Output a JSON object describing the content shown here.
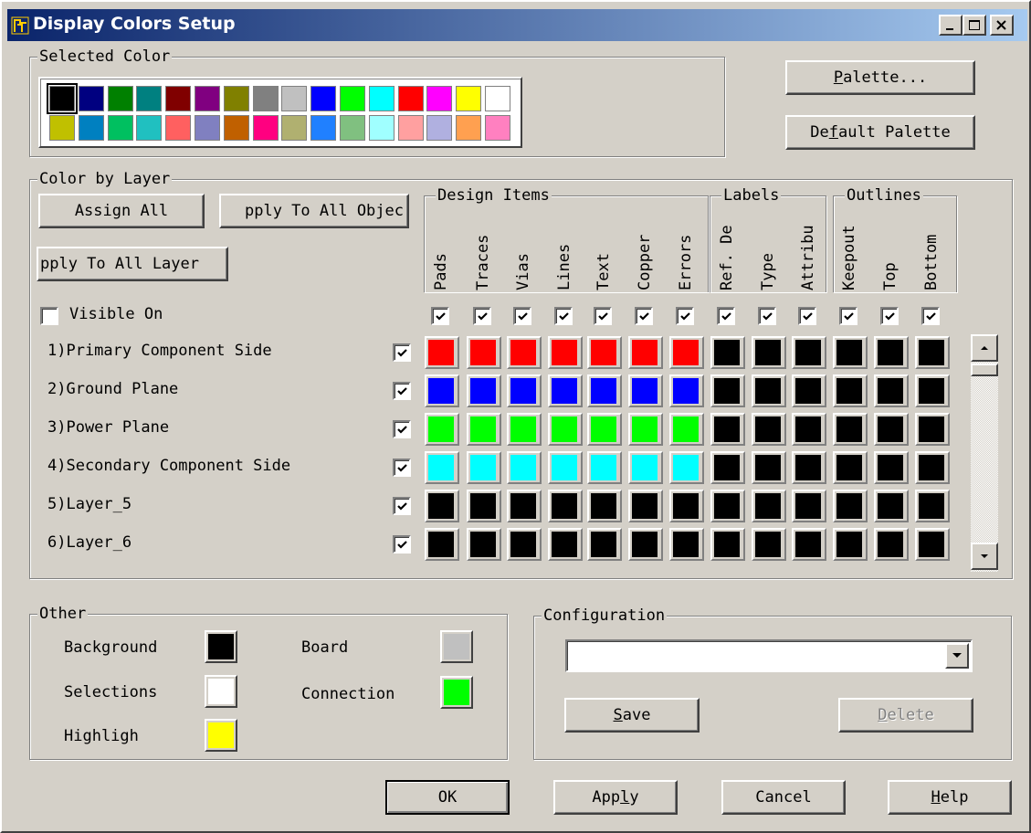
{
  "window": {
    "title": "Display Colors Setup",
    "icon": "app-icon",
    "controls": [
      "minimize-icon",
      "maximize-icon",
      "close-icon"
    ]
  },
  "selected_color": {
    "label": "Selected Color",
    "selected_index": 0,
    "palette": [
      "#000000",
      "#000080",
      "#008000",
      "#008080",
      "#800000",
      "#800080",
      "#808000",
      "#808080",
      "#c0c0c0",
      "#0000ff",
      "#00ff00",
      "#00ffff",
      "#ff0000",
      "#ff00ff",
      "#ffff00",
      "#ffffff",
      "#c0c000",
      "#0080c0",
      "#00c060",
      "#20c0c0",
      "#ff6060",
      "#8080c0",
      "#c06000",
      "#ff0080",
      "#b0b070",
      "#2080ff",
      "#80c080",
      "#a0ffff",
      "#ffa0a0",
      "#b0b0e0",
      "#ffa050",
      "#ff80c0"
    ]
  },
  "palette_buttons": {
    "palette": "Palette...",
    "palette_key": "P",
    "palette_rest": "alette...",
    "default_palette_pre": "De",
    "default_palette_key": "f",
    "default_palette_rest": "ault Palette"
  },
  "color_by_layer": {
    "label": "Color by Layer",
    "assign_all": "Assign All",
    "apply_to_all_objects": "pply To All Objec",
    "apply_to_all_layers": "pply To All Layer",
    "visible_on": "Visible On",
    "visible_on_checked": false,
    "groups": {
      "design_items": "Design Items",
      "labels": "Labels",
      "outlines": "Outlines"
    },
    "columns": [
      "Pads",
      "Traces",
      "Vias",
      "Lines",
      "Text",
      "Copper",
      "Errors",
      "Ref. De",
      "Type",
      "Attribu",
      "Keepout",
      "Top",
      "Bottom"
    ],
    "column_visible": [
      true,
      true,
      true,
      true,
      true,
      true,
      true,
      true,
      true,
      true,
      true,
      true,
      true
    ],
    "layers": [
      {
        "name": "1)Primary Component Side",
        "checked": true,
        "colors": [
          "#ff0000",
          "#ff0000",
          "#ff0000",
          "#ff0000",
          "#ff0000",
          "#ff0000",
          "#ff0000",
          "#000000",
          "#000000",
          "#000000",
          "#000000",
          "#000000",
          "#000000"
        ]
      },
      {
        "name": "2)Ground Plane",
        "checked": true,
        "colors": [
          "#0000ff",
          "#0000ff",
          "#0000ff",
          "#0000ff",
          "#0000ff",
          "#0000ff",
          "#0000ff",
          "#000000",
          "#000000",
          "#000000",
          "#000000",
          "#000000",
          "#000000"
        ]
      },
      {
        "name": "3)Power Plane",
        "checked": true,
        "colors": [
          "#00ff00",
          "#00ff00",
          "#00ff00",
          "#00ff00",
          "#00ff00",
          "#00ff00",
          "#00ff00",
          "#000000",
          "#000000",
          "#000000",
          "#000000",
          "#000000",
          "#000000"
        ]
      },
      {
        "name": "4)Secondary Component Side",
        "checked": true,
        "colors": [
          "#00ffff",
          "#00ffff",
          "#00ffff",
          "#00ffff",
          "#00ffff",
          "#00ffff",
          "#00ffff",
          "#000000",
          "#000000",
          "#000000",
          "#000000",
          "#000000",
          "#000000"
        ]
      },
      {
        "name": "5)Layer_5",
        "checked": true,
        "colors": [
          "#000000",
          "#000000",
          "#000000",
          "#000000",
          "#000000",
          "#000000",
          "#000000",
          "#000000",
          "#000000",
          "#000000",
          "#000000",
          "#000000",
          "#000000"
        ]
      },
      {
        "name": "6)Layer_6",
        "checked": true,
        "colors": [
          "#000000",
          "#000000",
          "#000000",
          "#000000",
          "#000000",
          "#000000",
          "#000000",
          "#000000",
          "#000000",
          "#000000",
          "#000000",
          "#000000",
          "#000000"
        ]
      }
    ]
  },
  "other": {
    "label": "Other",
    "background": {
      "label": "Background",
      "color": "#000000"
    },
    "selections": {
      "label": "Selections",
      "color": "#ffffff"
    },
    "highligh": {
      "label": "Highligh",
      "color": "#ffff00"
    },
    "board": {
      "label": "Board",
      "color": "#c0c0c0"
    },
    "connection": {
      "label": "Connection",
      "color": "#00ff00"
    }
  },
  "configuration": {
    "label": "Configuration",
    "value": "",
    "save_key": "S",
    "save_rest": "ave",
    "delete_key": "D",
    "delete_rest": "elete"
  },
  "footer": {
    "ok": "OK",
    "apply_pre": "App",
    "apply_key": "l",
    "apply_rest": "y",
    "cancel": "Cancel",
    "help_key": "H",
    "help_rest": "elp"
  }
}
